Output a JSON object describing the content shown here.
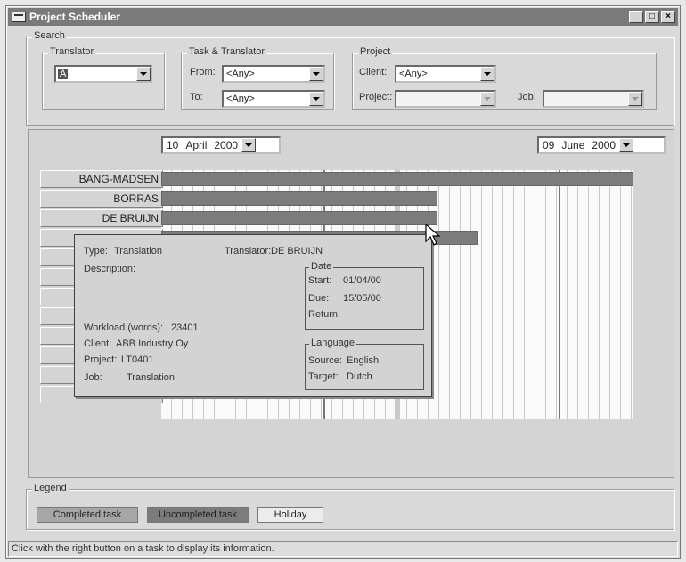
{
  "window": {
    "title": "Project Scheduler"
  },
  "search": {
    "group_label": "Search",
    "translator": {
      "label": "Translator",
      "value": "A"
    },
    "task_translator": {
      "label": "Task & Translator",
      "from_label": "From:",
      "from_value": "<Any>",
      "to_label": "To:",
      "to_value": "<Any>"
    },
    "project": {
      "label": "Project",
      "client_label": "Client:",
      "client_value": "<Any>",
      "project_label": "Project:",
      "project_value": "",
      "job_label": "Job:",
      "job_value": ""
    }
  },
  "range": {
    "start": {
      "day": "10",
      "month": "April",
      "year": "2000"
    },
    "end": {
      "day": "09",
      "month": "June",
      "year": "2000"
    }
  },
  "translators": [
    "BANG-MADSEN",
    "BORRAS",
    "DE BRUIJN",
    "",
    "",
    "",
    "",
    "",
    "",
    "",
    "",
    ""
  ],
  "tasks": [
    {
      "row": 0,
      "start": 0.0,
      "end": 1.0
    },
    {
      "row": 1,
      "start": 0.0,
      "end": 0.585
    },
    {
      "row": 2,
      "start": 0.0,
      "end": 0.585
    },
    {
      "row": 3,
      "start": 0.0,
      "end": 0.67
    }
  ],
  "popup": {
    "type_label": "Type:",
    "type_value": "Translation",
    "translator_label": "Translator:",
    "translator_value": "DE BRUIJN",
    "description_label": "Description:",
    "workload_label": "Workload (words):",
    "workload_value": "23401",
    "client_label": "Client:",
    "client_value": "ABB Industry Oy",
    "project_label": "Project:",
    "project_value": "LT0401",
    "job_label": "Job:",
    "job_value": "Translation",
    "date_group": "Date",
    "start_label": "Start:",
    "start_value": "01/04/00",
    "due_label": "Due:",
    "due_value": "15/05/00",
    "return_label": "Return:",
    "language_group": "Language",
    "source_label": "Source:",
    "source_value": "English",
    "target_label": "Target:",
    "target_value": "Dutch"
  },
  "legend": {
    "label": "Legend",
    "items": [
      {
        "label": "Completed task",
        "color": "#a6a6a6"
      },
      {
        "label": "Uncompleted task",
        "color": "#7c7c7c"
      },
      {
        "label": "Holiday",
        "color": "#ececec"
      }
    ]
  },
  "status": "Click with the right button on a task to display its information."
}
